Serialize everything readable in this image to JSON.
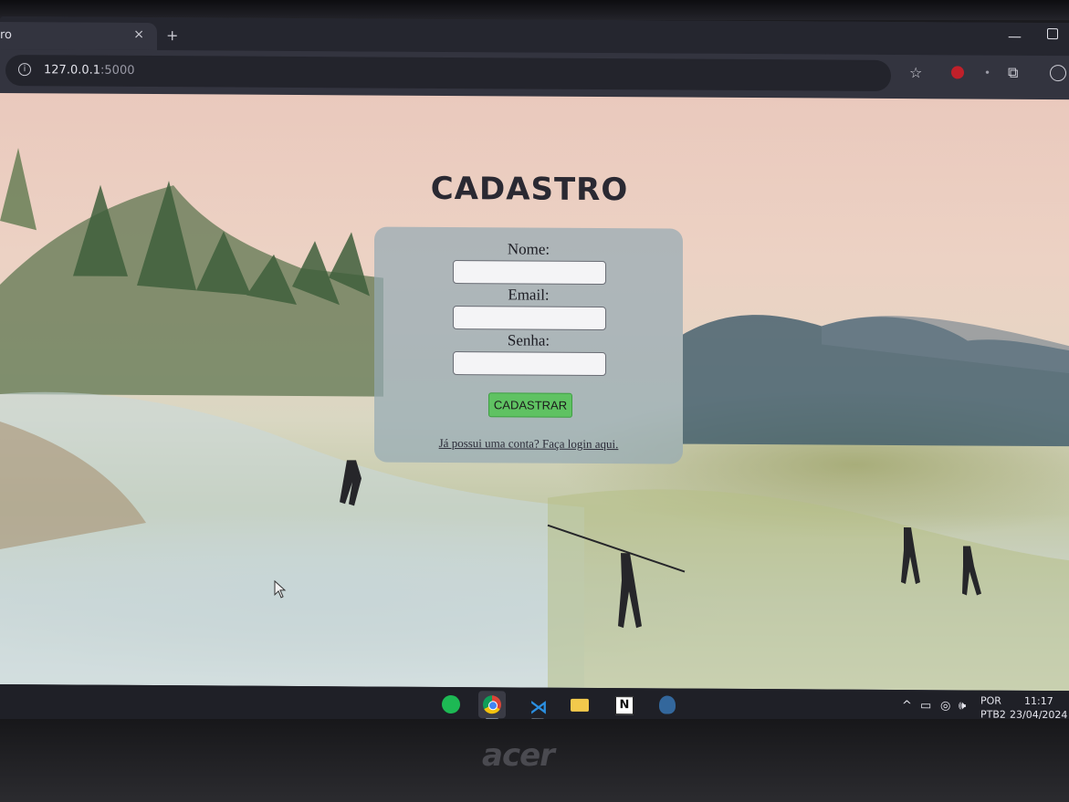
{
  "browser": {
    "tab_title": "ro",
    "tab_close": "×",
    "new_tab": "+",
    "url_host": "127.0.0.1",
    "url_port": ":5000"
  },
  "page": {
    "title": "CADASTRO",
    "form": {
      "name_label": "Nome:",
      "name_value": "",
      "email_label": "Email:",
      "email_value": "",
      "password_label": "Senha:",
      "password_value": "",
      "submit_label": "CADASTRAR",
      "login_link": "Já possui uma conta? Faça login aqui."
    },
    "button_color": "#5fc262"
  },
  "taskbar": {
    "apps": [
      "spotify-icon",
      "chrome-icon",
      "vscode-icon",
      "file-explorer-icon",
      "notion-icon",
      "pgadmin-icon"
    ],
    "notion_glyph": "N",
    "lang_line1": "POR",
    "lang_line2": "PTB2",
    "time": "11:17",
    "date": "23/04/2024"
  },
  "device": {
    "brand": "acer"
  }
}
